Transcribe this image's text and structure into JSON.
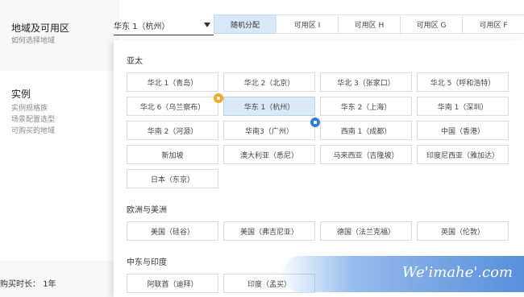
{
  "left": {
    "region_title": "地域及可用区",
    "region_sub": "如何选择地域",
    "instance_title": "实例",
    "instance_sub": [
      "实例规格族",
      "场景配置选型",
      "可购买的地域"
    ],
    "duration_label": "购买时长：",
    "duration_value": "1年"
  },
  "region_select": {
    "value": "华东 1（杭州）"
  },
  "zone_tabs": [
    "随机分配",
    "可用区 I",
    "可用区 H",
    "可用区 G",
    "可用区 F"
  ],
  "active_tab": 0,
  "groups": [
    {
      "title": "亚太",
      "zones": [
        "华北 1（青岛）",
        "华北 2（北京）",
        "华北 3（张家口）",
        "华北 5（呼和浩特）",
        "华北 6（乌兰察布）",
        "华东 1（杭州）",
        "华东 2（上海）",
        "华南 1（深圳）",
        "华南 2（河源）",
        "华南3（广州）",
        "西南 1（成都）",
        "中国（香港）",
        "新加坡",
        "澳大利亚（悉尼）",
        "马来西亚（吉隆坡）",
        "印度尼西亚（雅加达）",
        "日本（东京）"
      ]
    },
    {
      "title": "欧洲与美洲",
      "zones": [
        "美国（硅谷）",
        "美国（弗吉尼亚）",
        "德国（法兰克福）",
        "英国（伦敦）"
      ]
    },
    {
      "title": "中东与印度",
      "zones": [
        "阿联酋（迪拜）",
        "印度（孟买）"
      ]
    }
  ],
  "selected_zone": "华东 1（杭州）",
  "badges": [
    {
      "zone": "华北 6（乌兰察布）",
      "color": "#f5a623",
      "icon": "tag-orange-icon"
    },
    {
      "zone": "华南3（广州）",
      "color": "#2f7fd3",
      "icon": "tag-blue-icon"
    }
  ],
  "watermark": "We'imahe'.com"
}
